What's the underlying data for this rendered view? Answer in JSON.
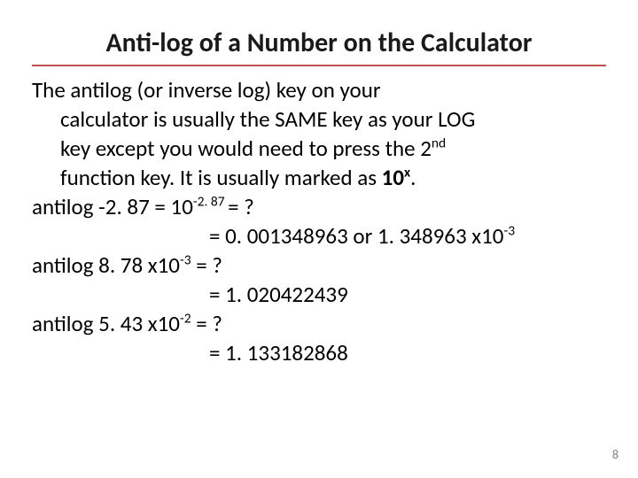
{
  "title": "Anti-log of a Number on the Calculator",
  "intro": {
    "l1a": "The antilog (or inverse log) key on your",
    "l2": "calculator is usually the SAME key as your LOG",
    "l3a": "key except you would need to press the 2",
    "l3sup": "nd",
    "l4a": "function key.  It is usually marked as ",
    "l4b": "10",
    "l4sup": "x",
    "l4c": "."
  },
  "ex1": {
    "q_a": "antilog -2. 87 = 10",
    "q_sup": "-2. 87 ",
    "q_b": "= ?",
    "r_a": "= 0. 001348963 or 1. 348963 x10",
    "r_sup": "-3"
  },
  "ex2": {
    "q_a": "antilog 8. 78 x10",
    "q_sup": "-3",
    "q_b": " = ?",
    "r": "= 1. 020422439"
  },
  "ex3": {
    "q_a": "antilog 5. 43 x10",
    "q_sup": "-2",
    "q_b": " = ?",
    "r": "= 1. 133182868"
  },
  "page_number": "8"
}
